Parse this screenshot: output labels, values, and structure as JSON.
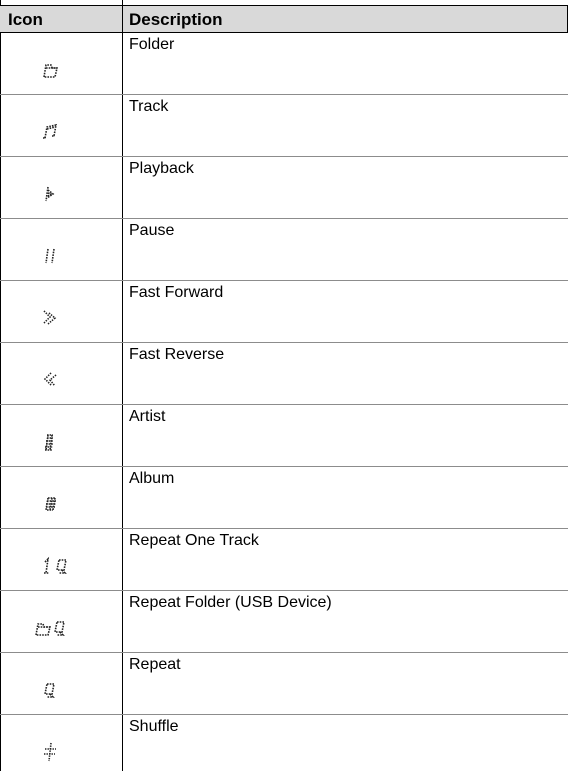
{
  "table": {
    "header": {
      "icon": "Icon",
      "description": "Description"
    },
    "rows": [
      {
        "icon": "folder-icon",
        "description": "Folder"
      },
      {
        "icon": "track-icon",
        "description": "Track"
      },
      {
        "icon": "playback-icon",
        "description": "Playback"
      },
      {
        "icon": "pause-icon",
        "description": "Pause"
      },
      {
        "icon": "fast-forward-icon",
        "description": "Fast Forward"
      },
      {
        "icon": "fast-reverse-icon",
        "description": "Fast Reverse"
      },
      {
        "icon": "artist-icon",
        "description": "Artist"
      },
      {
        "icon": "album-icon",
        "description": "Album"
      },
      {
        "icon": "repeat-one-track-icon",
        "description": "Repeat One Track"
      },
      {
        "icon": "repeat-folder-icon",
        "description": "Repeat Folder (USB Device)"
      },
      {
        "icon": "repeat-icon",
        "description": "Repeat"
      },
      {
        "icon": "shuffle-icon",
        "description": "Shuffle"
      }
    ]
  }
}
